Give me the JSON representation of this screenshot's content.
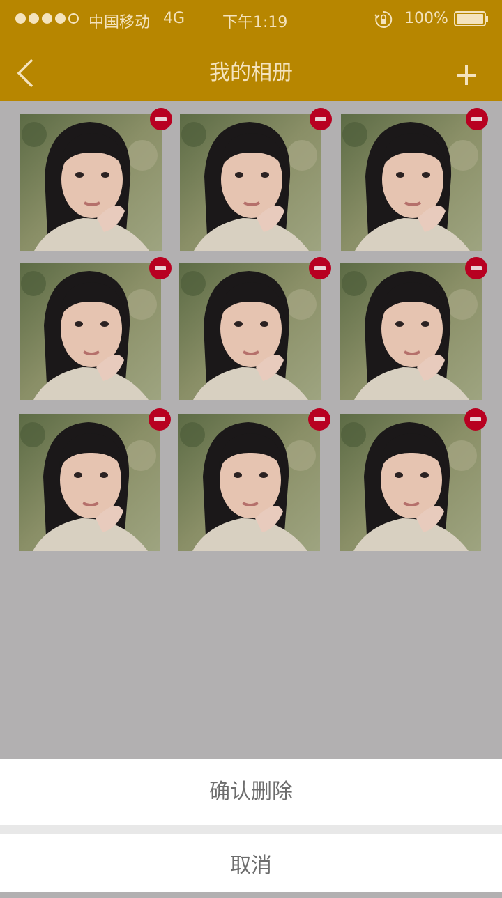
{
  "status_bar": {
    "carrier": "中国移动",
    "network": "4G",
    "time": "下午1:19",
    "battery": "100%",
    "signal_level": 4,
    "signal_max": 5
  },
  "navbar": {
    "title": "我的相册",
    "back_icon": "chevron-left-icon",
    "add_icon": "plus-icon"
  },
  "album": {
    "photo_count": 9,
    "delete_icon": "minus-circle-icon"
  },
  "action_sheet": {
    "confirm_label": "确认删除",
    "cancel_label": "取消"
  },
  "colors": {
    "header_dimmed": "#b78600",
    "overlay": "#b2b0b1",
    "delete_badge": "#b80021",
    "sheet_text": "#6d6d6d"
  }
}
